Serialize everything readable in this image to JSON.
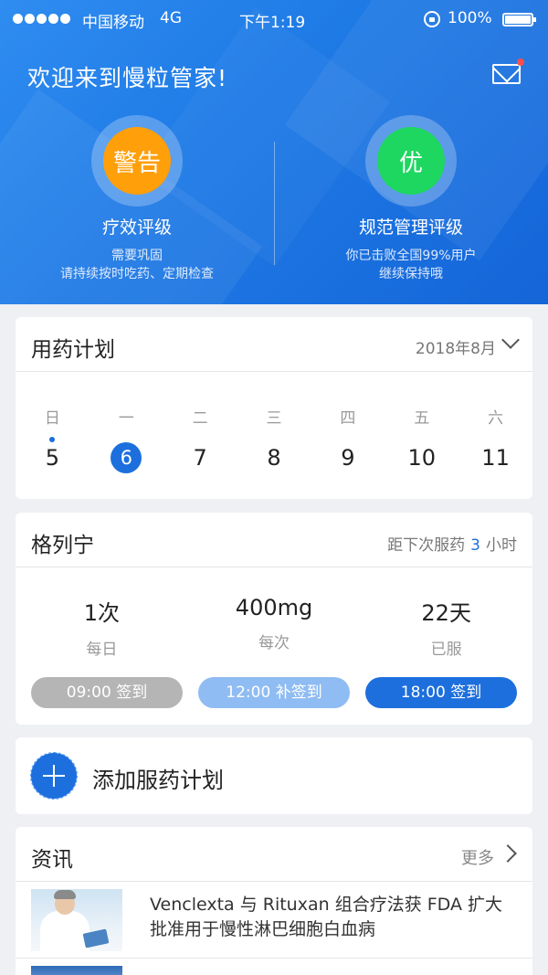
{
  "status_bar": {
    "carrier": "中国移动",
    "network": "4G",
    "time": "下午1:19",
    "battery": "100%"
  },
  "header": {
    "welcome": "欢迎来到慢粒管家!",
    "ratings": [
      {
        "badge": "警告",
        "badge_color": "#ff9f0a",
        "title": "疗效评级",
        "sub1": "需要巩固",
        "sub2": "请持续按时吃药、定期检查"
      },
      {
        "badge": "优",
        "badge_color": "#1ed760",
        "title": "规范管理评级",
        "sub1": "你已击败全国99%用户",
        "sub2": "继续保持哦"
      }
    ]
  },
  "plan": {
    "title": "用药计划",
    "month": "2018年8月",
    "days": [
      {
        "weekday": "日",
        "date": "5"
      },
      {
        "weekday": "一",
        "date": "6"
      },
      {
        "weekday": "二",
        "date": "7"
      },
      {
        "weekday": "三",
        "date": "8"
      },
      {
        "weekday": "四",
        "date": "9"
      },
      {
        "weekday": "五",
        "date": "10"
      },
      {
        "weekday": "六",
        "date": "11"
      }
    ]
  },
  "medication": {
    "name": "格列宁",
    "next_prefix": "距下次服药",
    "next_hours": "3",
    "next_suffix": "小时",
    "stats": [
      {
        "value": "1次",
        "label": "每日"
      },
      {
        "value": "400mg",
        "label": "每次"
      },
      {
        "value": "22天",
        "label": "已服"
      }
    ],
    "checkins": [
      {
        "label": "09:00  签到",
        "color": "#b5b5b5"
      },
      {
        "label": "12:00  补签到",
        "color": "#8fbcf2"
      },
      {
        "label": "18:00  签到",
        "color": "#1d6fdd"
      }
    ]
  },
  "add_plan": {
    "label": "添加服药计划"
  },
  "news": {
    "title": "资讯",
    "more": "更多",
    "items": [
      {
        "text": "Venclexta 与 Rituxan 组合疗法获 FDA 扩大批准用于慢性淋巴细胞白血病"
      }
    ]
  }
}
